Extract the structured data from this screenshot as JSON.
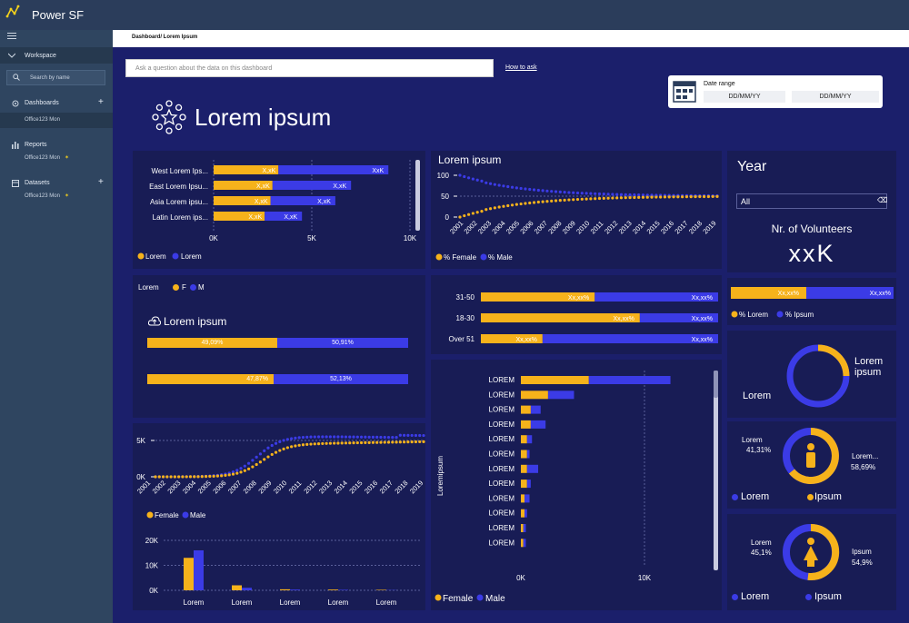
{
  "app": {
    "title": "Power SF"
  },
  "sidebar": {
    "workspace": "Workspace",
    "search_placeholder": "Search by name",
    "items": [
      {
        "label": "Dashboards",
        "sub": "Office123 Mon"
      },
      {
        "label": "Reports",
        "sub": "Office123 Mon"
      },
      {
        "label": "Datasets",
        "sub": "Office123 Mon"
      }
    ]
  },
  "breadcrumb": "Dashboard/ Lorem Ipsum",
  "qa": {
    "placeholder": "Ask a question about the data on this dashboard",
    "howto": "How to ask"
  },
  "date_range": {
    "label": "Date range",
    "from": "DD/MM/YY",
    "to": "DD/MM/YY"
  },
  "page_title": "Lorem ipsum",
  "colors": {
    "female": "#f6b21b",
    "male": "#3b3be6",
    "bg": "#1b1f6b",
    "panel": "#181c55"
  },
  "year_panel": {
    "title": "Year",
    "select": "All"
  },
  "volunteers": {
    "title": "Nr. of Volunteers",
    "value": "xxK"
  },
  "region_chart": {
    "rows": [
      "West Lorem Ips...",
      "East Lorem Ipsu...",
      "Asia Lorem ipsu...",
      "Latin Lorem ips..."
    ],
    "label_a": [
      "X,xK",
      "X,xK",
      "X,xK",
      "X,xK"
    ],
    "label_b": [
      "XxK",
      "X,xK",
      "X,xK",
      "X,xK"
    ],
    "a": [
      3.3,
      3.0,
      2.9,
      2.6
    ],
    "b": [
      5.6,
      4.0,
      3.3,
      1.9
    ],
    "xticks": [
      "0K",
      "5K",
      "10K"
    ],
    "legend": [
      "Lorem",
      "Lorem"
    ]
  },
  "pct_line": {
    "title": "Lorem ipsum",
    "yticks": [
      "100",
      "50",
      "0"
    ],
    "years": [
      "2001",
      "2002",
      "2003",
      "2004",
      "2005",
      "2006",
      "2007",
      "2008",
      "2009",
      "2010",
      "2011",
      "2012",
      "2013",
      "2014",
      "2015",
      "2016",
      "2017",
      "2018",
      "2019"
    ],
    "legend": [
      "% Female",
      "% Male"
    ]
  },
  "age_bars": {
    "rows": [
      "31-50",
      "18-30",
      "Over 51"
    ],
    "female_pct": [
      0.48,
      0.67,
      0.26
    ],
    "labels_f": [
      "Xx,xx%",
      "Xx,xx%",
      "Xx,xx%"
    ],
    "labels_m": [
      "Xx,xx%",
      "Xx,xx%",
      "Xx,xx%"
    ]
  },
  "gender_panel": {
    "legend_title": "Lorem",
    "legend": [
      "F",
      "M"
    ],
    "title": "Lorem ipsum",
    "row1": [
      "49,09%",
      "50,91%"
    ],
    "row2": [
      "47,87%",
      "52,13%"
    ]
  },
  "side_bar": {
    "f": "Xx,xx%",
    "m": "Xx,xx%",
    "legend": [
      "% Lorem",
      "% Ipsum"
    ]
  },
  "donut1": {
    "a": "Lorem",
    "b": "Lorem ipsum"
  },
  "donut2": {
    "left": "Lorem",
    "left_pct": "41,31%",
    "right": "Lorem...",
    "right_pct": "58,69%",
    "legend": [
      "Lorem",
      "Ipsum"
    ]
  },
  "donut3": {
    "left": "Lorem",
    "left_pct": "45,1%",
    "right": "Ipsum",
    "right_pct": "54,9%",
    "legend": [
      "Lorem",
      "Ipsum"
    ]
  },
  "trend": {
    "yticks": [
      "5K",
      "0K"
    ],
    "years": [
      "2001",
      "2002",
      "2003",
      "2004",
      "2005",
      "2006",
      "2007",
      "2008",
      "2009",
      "2010",
      "2011",
      "2012",
      "2013",
      "2014",
      "2015",
      "2016",
      "2017",
      "2018",
      "2019"
    ],
    "legend": [
      "Female",
      "Male"
    ]
  },
  "small_bars": {
    "yticks": [
      "20K",
      "10K",
      "0K"
    ],
    "cats": [
      "Lorem",
      "Lorem",
      "Lorem",
      "Lorem",
      "Lorem"
    ],
    "female": [
      13,
      2,
      0.4,
      0.3,
      0.2
    ],
    "male": [
      16,
      1,
      0.3,
      0.2,
      0.1
    ]
  },
  "hbars": {
    "ylabel": "Loremipsum",
    "cats": [
      "LOREM",
      "LOREM",
      "LOREM",
      "LOREM",
      "LOREM",
      "LOREM",
      "LOREM",
      "LOREM",
      "LOREM",
      "LOREM",
      "LOREM",
      "LOREM"
    ],
    "female": [
      5.5,
      2.2,
      0.8,
      0.8,
      0.5,
      0.5,
      0.5,
      0.5,
      0.3,
      0.3,
      0.2,
      0.2
    ],
    "male": [
      6.6,
      2.1,
      0.8,
      1.2,
      0.4,
      0.2,
      0.9,
      0.3,
      0.4,
      0.2,
      0.2,
      0.2
    ],
    "xticks": [
      "0K",
      "10K"
    ],
    "legend": [
      "Female",
      "Male"
    ]
  }
}
